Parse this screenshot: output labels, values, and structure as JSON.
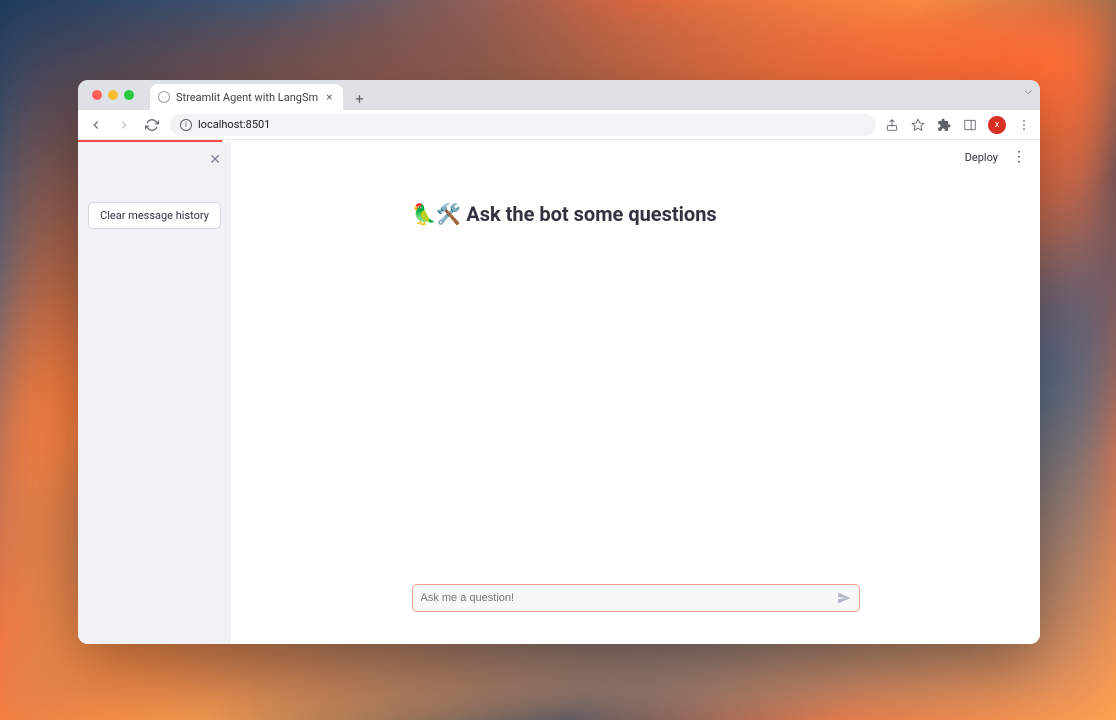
{
  "browser": {
    "tab_title": "Streamlit Agent with LangSm",
    "url": "localhost:8501"
  },
  "sidebar": {
    "clear_button": "Clear message history"
  },
  "topbar": {
    "deploy": "Deploy"
  },
  "main": {
    "heading": "🦜🛠️ Ask the bot some questions"
  },
  "chat": {
    "placeholder": "Ask me a question!"
  }
}
